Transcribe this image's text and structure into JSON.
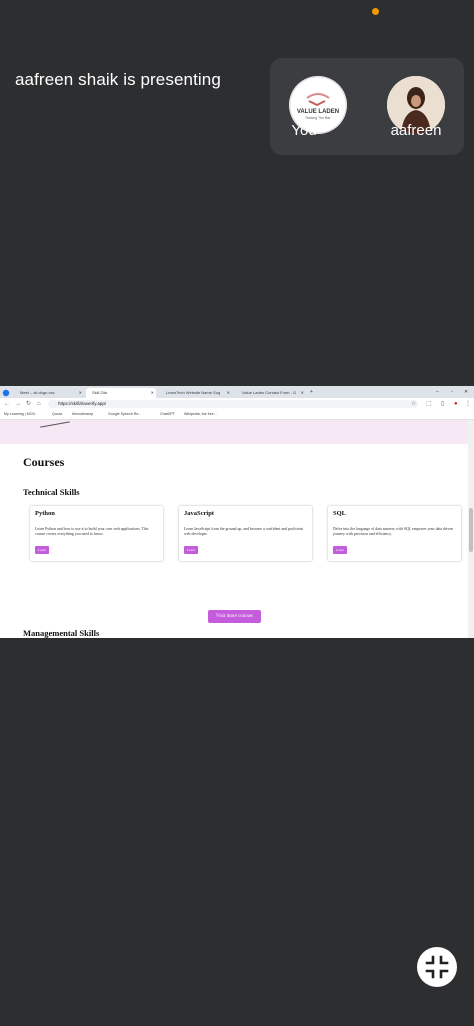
{
  "meet": {
    "presenting_text": "aafreen shaik is presenting",
    "participants": [
      {
        "name": "You",
        "avatar_logo_text": "VALUE LADEN",
        "avatar_logo_sub": "Raising The Bar"
      },
      {
        "name": "aafreen"
      }
    ],
    "exit_fullscreen_icon": "exit-fullscreen-icon"
  },
  "browser": {
    "tabs": [
      {
        "label": "Meet – zit-dxgn-vsc"
      },
      {
        "label": "Skill Zila"
      },
      {
        "label": "LearnTech Website Name Sug"
      },
      {
        "label": "Value Laden Contact Form - G"
      }
    ],
    "url": "https://skillzilaverify.app/",
    "bookmarks": [
      "My Learning | MOV..",
      "Quora",
      "thenoderamp",
      "Google Speech Re...",
      "ChatGPT",
      "Wikipedia, the free..."
    ]
  },
  "page": {
    "heading": "Courses",
    "tech_heading": "Technical Skills",
    "courses": [
      {
        "title": "Python",
        "desc": "Learn Python and how to use it to build your own web applications. This course covers everything you need to know.",
        "button": "Learn"
      },
      {
        "title": "JavaScript",
        "desc": "Learn JavaScript from the ground up, and become a confident and proficient web developer.",
        "button": "Learn"
      },
      {
        "title": "SQL",
        "desc": "Delve into the language of data mastery with SQL empower your data driven journey with precision and efficiency.",
        "button": "Learn"
      }
    ],
    "visit_button": "Visit more courses",
    "mgmt_heading": "Managemental Skills"
  }
}
